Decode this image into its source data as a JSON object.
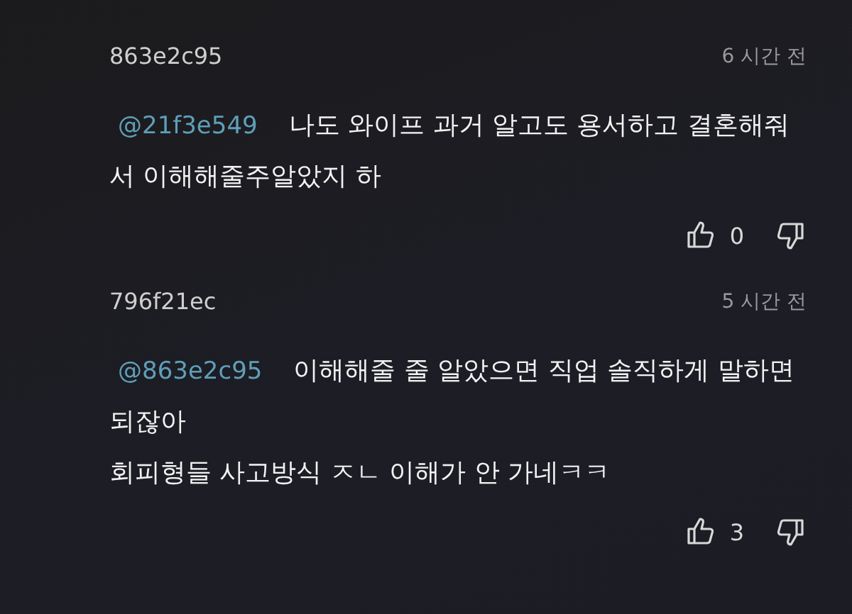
{
  "comments": [
    {
      "author": "863e2c95",
      "time": "6 시간 전",
      "mention": "@21f3e549",
      "text": "나도 와이프 과거 알고도 용서하고 결혼해줘서 이해해줄주알았지 하",
      "likes": "0"
    },
    {
      "author": "796f21ec",
      "time": "5 시간 전",
      "mention": "@863e2c95",
      "text": "이해해줄 줄 알았으면 직업 솔직하게 말하면 되잖아\n회피형들 사고방식 ㅈㄴ 이해가 안 가네ㅋㅋ",
      "likes": "3"
    }
  ]
}
